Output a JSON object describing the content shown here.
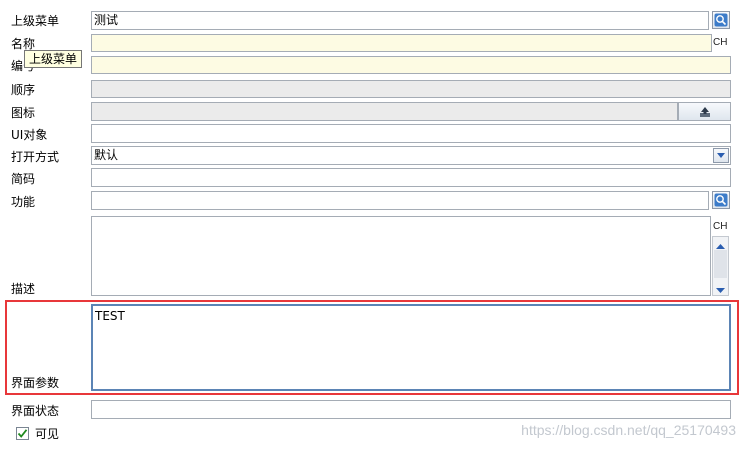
{
  "form": {
    "parent_menu": {
      "label": "上级菜单",
      "value": "测试"
    },
    "name": {
      "label": "名称",
      "value": ""
    },
    "code": {
      "label": "编号",
      "value": ""
    },
    "order": {
      "label": "顺序",
      "value": ""
    },
    "icon": {
      "label": "图标",
      "value": ""
    },
    "ui_object": {
      "label": "UI对象",
      "value": ""
    },
    "open_mode": {
      "label": "打开方式",
      "value": "默认"
    },
    "short_code": {
      "label": "简码",
      "value": ""
    },
    "function": {
      "label": "功能",
      "value": ""
    },
    "description": {
      "label": "描述",
      "value": ""
    },
    "ui_params": {
      "label": "界面参数",
      "value": "TEST"
    },
    "ui_state": {
      "label": "界面状态",
      "value": ""
    },
    "visible": {
      "label": "可见",
      "checked": true
    }
  },
  "tooltip": {
    "text": "上级菜单"
  },
  "ch_label": "CH",
  "watermark": "https://blog.csdn.net/qq_25170493",
  "colors": {
    "highlight": "#e8373a",
    "required_bg": "#fdfbe3",
    "readonly_bg": "#ebebeb"
  },
  "icons": [
    "lookup-icon",
    "upload-icon",
    "dropdown-arrow-icon",
    "scroll-up-icon",
    "scroll-down-icon",
    "checkbox-check-icon"
  ]
}
